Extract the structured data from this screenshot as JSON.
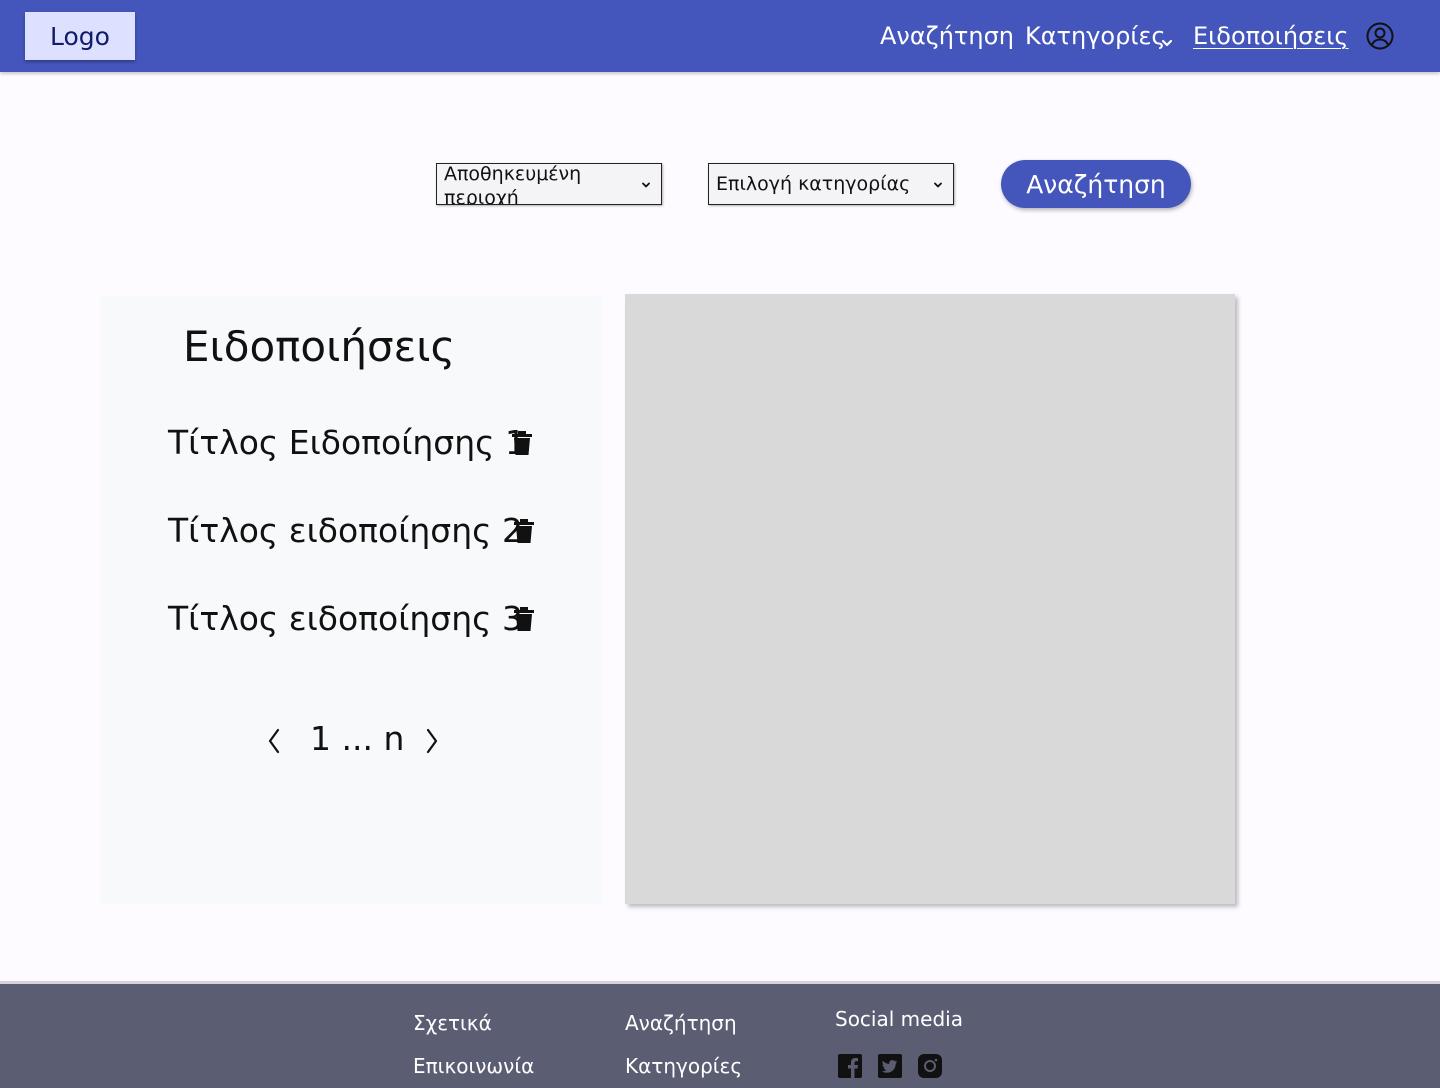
{
  "header": {
    "logo": "Logo",
    "nav": {
      "search": "Αναζήτηση",
      "categories": "Κατηγορίες",
      "notifications": "Ειδοποιήσεις"
    },
    "active_nav": "notifications"
  },
  "filters": {
    "area_select": "Αποθηκευμένη περιοχή",
    "category_select": "Επιλογή κατηγορίας",
    "search_button": "Αναζήτηση"
  },
  "notifications": {
    "title": "Ειδοποιήσεις",
    "items": [
      {
        "label": "Τίτλος Ειδοποίησης 1"
      },
      {
        "label": "Τίτλος ειδοποίησης 2"
      },
      {
        "label": "Τίτλος ειδοποίησης 3"
      }
    ],
    "pager": "1 ... n"
  },
  "footer": {
    "about": "Σχετικά",
    "contact": "Επικοινωνία",
    "search": "Αναζήτηση",
    "categories": "Κατηγορίες",
    "social_title": "Social media",
    "social_icons": [
      "facebook-icon",
      "twitter-icon",
      "instagram-icon"
    ]
  },
  "colors": {
    "primary": "#4456bb",
    "logo_bg": "#dee0ff",
    "footer_bg": "#5b5d72",
    "panel_bg": "#f8f9fa",
    "map_placeholder": "#d9d9d9"
  }
}
